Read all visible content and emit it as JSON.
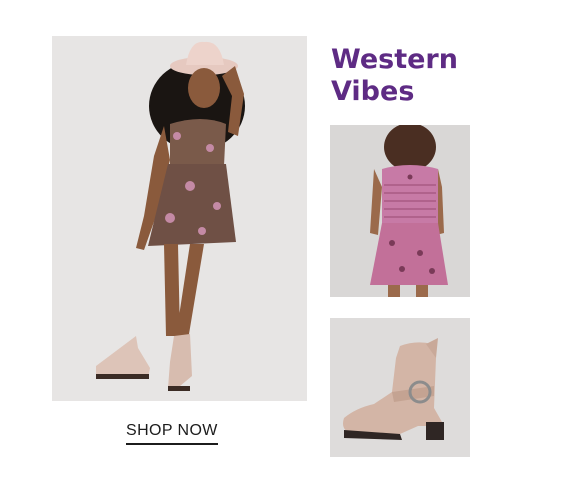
{
  "headline": {
    "line1": "Western",
    "line2": "Vibes",
    "color": "#5e2b84"
  },
  "cta": {
    "label": "SHOP NOW"
  },
  "images": {
    "main": "girl-in-floral-dress-with-cowboy-hat-and-boots",
    "back": "pink-floral-smocked-dress-back-view",
    "boot": "tan-western-ankle-boot"
  }
}
